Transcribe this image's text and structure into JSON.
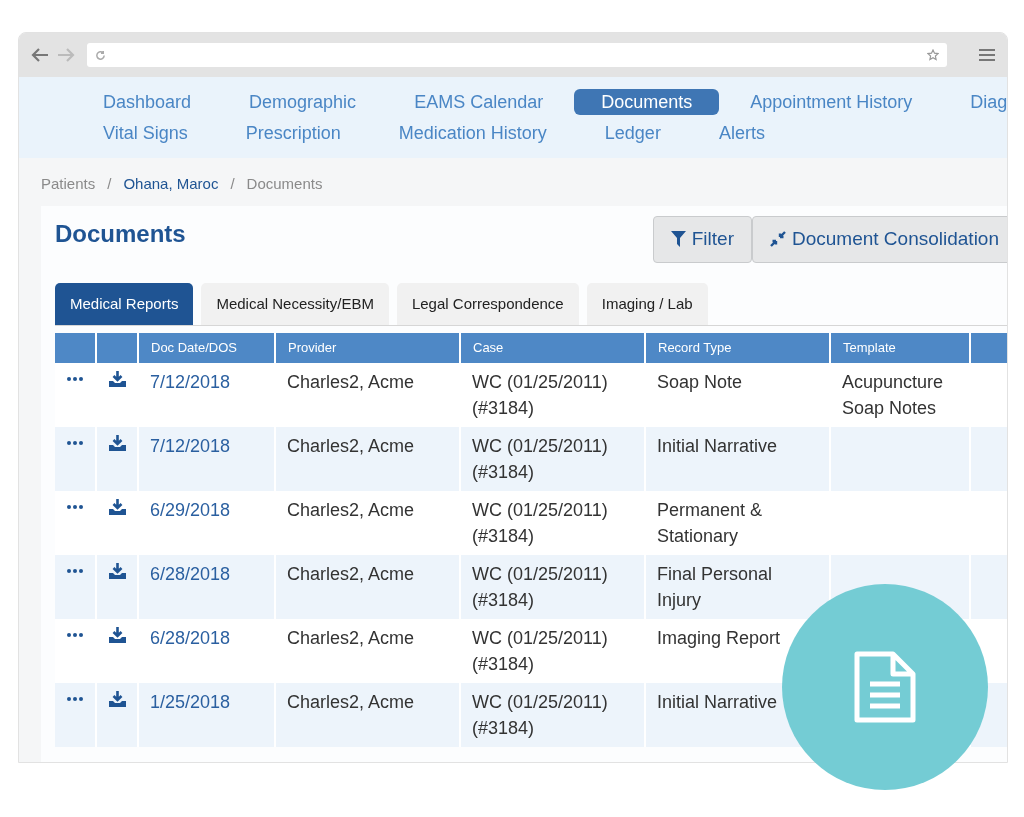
{
  "nav_rows": [
    [
      {
        "label": "Dashboard",
        "selected": false
      },
      {
        "label": "Demographic",
        "selected": false
      },
      {
        "label": "EAMS Calendar",
        "selected": false
      },
      {
        "label": "Documents",
        "selected": true
      },
      {
        "label": "Appointment History",
        "selected": false
      },
      {
        "label": "Diag",
        "selected": false
      }
    ],
    [
      {
        "label": "Vital Signs",
        "selected": false
      },
      {
        "label": "Prescription",
        "selected": false
      },
      {
        "label": "Medication History",
        "selected": false
      },
      {
        "label": "Ledger",
        "selected": false
      },
      {
        "label": "Alerts",
        "selected": false
      }
    ]
  ],
  "breadcrumb": [
    {
      "label": "Patients",
      "kind": "plain"
    },
    {
      "label": "/",
      "kind": "separator"
    },
    {
      "label": "Ohana, Maroc",
      "kind": "link"
    },
    {
      "label": "/",
      "kind": "separator"
    },
    {
      "label": "Documents",
      "kind": "plain"
    }
  ],
  "title": "Documents",
  "actions": [
    {
      "label": "Filter",
      "kind": "filter"
    },
    {
      "label": "Document Consolidation",
      "kind": "consolidate"
    }
  ],
  "tabs": [
    {
      "label": "Medical Reports",
      "selected": true
    },
    {
      "label": "Medical Necessity/EBM",
      "selected": false
    },
    {
      "label": "Legal Correspondence",
      "selected": false
    },
    {
      "label": "Imaging / Lab",
      "selected": false
    }
  ],
  "table": {
    "columns": [
      "Doc Date/DOS",
      "Provider",
      "Case",
      "Record Type",
      "Template"
    ],
    "rows": [
      {
        "date": "7/12/2018",
        "provider": "Charles2, Acme",
        "case": "WC (01/25/2011) (#3184)",
        "record_type": "Soap Note",
        "template": "Acupuncture Soap Notes"
      },
      {
        "date": "7/12/2018",
        "provider": "Charles2, Acme",
        "case": "WC (01/25/2011) (#3184)",
        "record_type": "Initial Narrative"
      },
      {
        "date": "6/29/2018",
        "provider": "Charles2, Acme",
        "case": "WC (01/25/2011) (#3184)",
        "record_type": "Permanent & Stationary"
      },
      {
        "date": "6/28/2018",
        "provider": "Charles2, Acme",
        "case": "WC (01/25/2011) (#3184)",
        "record_type": "Final Personal Injury"
      },
      {
        "date": "6/28/2018",
        "provider": "Charles2, Acme",
        "case": "WC (01/25/2011) (#3184)",
        "record_type": "Imaging Report"
      },
      {
        "date": "1/25/2018",
        "provider": "Charles2, Acme",
        "case": "WC (01/25/2011) (#3184)",
        "record_type": "Initial Narrative"
      }
    ]
  }
}
